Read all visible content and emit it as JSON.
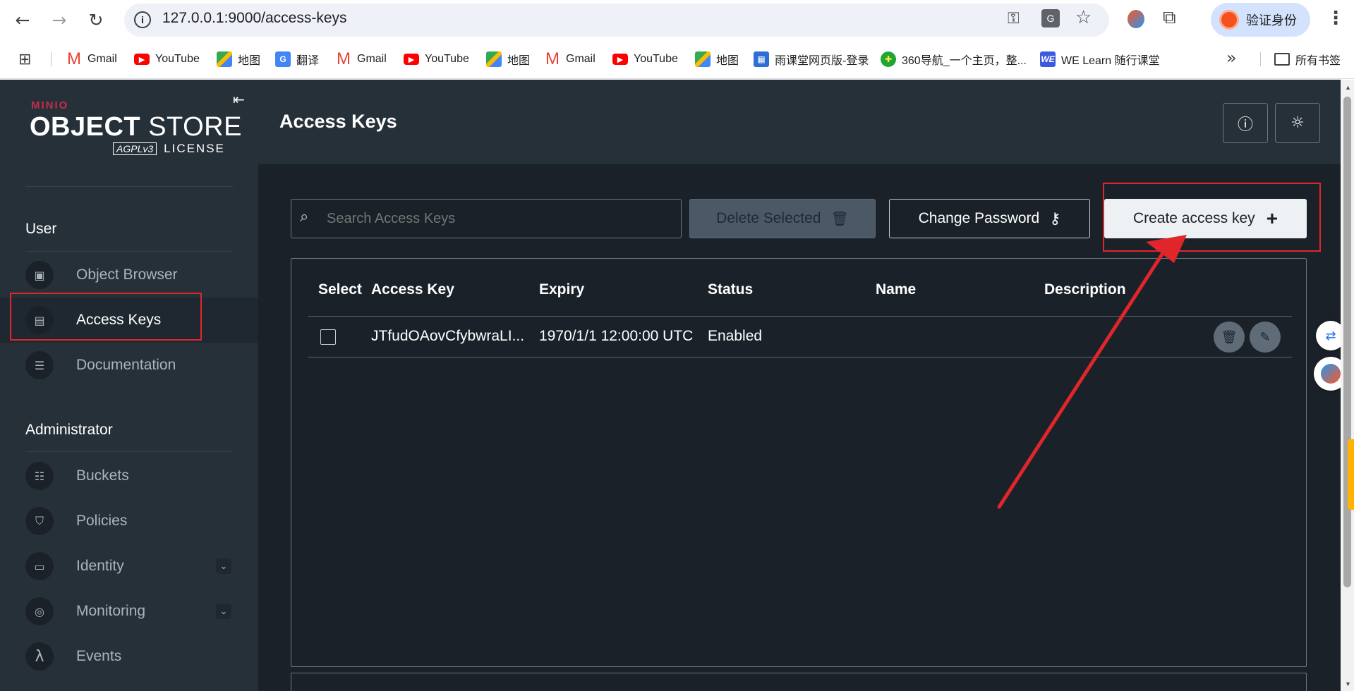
{
  "browser": {
    "url": "127.0.0.1:9000/access-keys",
    "profile_label": "验证身份",
    "all_bookmarks_label": "所有书签",
    "bookmarks": [
      {
        "label": "Gmail",
        "icon": "gmail-icon"
      },
      {
        "label": "YouTube",
        "icon": "youtube-icon"
      },
      {
        "label": "地图",
        "icon": "maps-icon"
      },
      {
        "label": "翻译",
        "icon": "translate-icon"
      },
      {
        "label": "Gmail",
        "icon": "gmail-icon"
      },
      {
        "label": "YouTube",
        "icon": "youtube-icon"
      },
      {
        "label": "地图",
        "icon": "maps-icon"
      },
      {
        "label": "Gmail",
        "icon": "gmail-icon"
      },
      {
        "label": "YouTube",
        "icon": "youtube-icon"
      },
      {
        "label": "地图",
        "icon": "maps-icon"
      },
      {
        "label": "雨课堂网页版-登录",
        "icon": "yuketang-icon"
      },
      {
        "label": "360导航_一个主页，整...",
        "icon": "360-icon"
      },
      {
        "label": "WE Learn 随行课堂",
        "icon": "welearn-icon"
      }
    ]
  },
  "sidebar": {
    "logo": {
      "brand": "MINIO",
      "product_a": "OBJECT",
      "product_b": "STORE",
      "agpl": "AGPLv3",
      "license": "LICENSE"
    },
    "user_section": "User",
    "user_items": [
      {
        "label": "Object Browser",
        "icon": "object-browser-icon"
      },
      {
        "label": "Access Keys",
        "icon": "access-keys-icon"
      },
      {
        "label": "Documentation",
        "icon": "documentation-icon"
      }
    ],
    "admin_section": "Administrator",
    "admin_items": [
      {
        "label": "Buckets",
        "icon": "buckets-icon"
      },
      {
        "label": "Policies",
        "icon": "policies-icon"
      },
      {
        "label": "Identity",
        "icon": "identity-icon"
      },
      {
        "label": "Monitoring",
        "icon": "monitoring-icon"
      },
      {
        "label": "Events",
        "icon": "lambda-icon"
      }
    ]
  },
  "header": {
    "title": "Access Keys"
  },
  "toolbar": {
    "search_placeholder": "Search Access Keys",
    "delete_label": "Delete Selected",
    "change_password_label": "Change Password",
    "create_label": "Create access key"
  },
  "table": {
    "columns": [
      "Select",
      "Access Key",
      "Expiry",
      "Status",
      "Name",
      "Description"
    ],
    "rows": [
      {
        "access_key": "JTfudOAovCfybwraLI...",
        "expiry": "1970/1/1 12:00:00 UTC",
        "status": "Enabled",
        "name": "",
        "description": ""
      }
    ]
  },
  "colors": {
    "accent_red": "#e0262b",
    "sidebar_bg": "#263039",
    "main_bg": "#1b2129",
    "minio_red": "#c72c48"
  }
}
